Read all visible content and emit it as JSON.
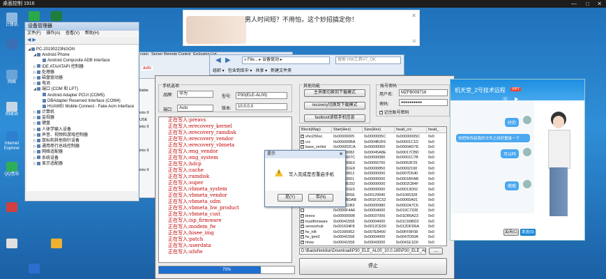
{
  "remote": {
    "title": "桌面控制 1916",
    "min": "—",
    "max": "□",
    "close": "✕"
  },
  "desktop_icons": [
    {
      "label": "计算机",
      "color": "#8fb8e0"
    },
    {
      "label": "",
      "color": "#2aa84a"
    },
    {
      "label": "",
      "color": "#1e7e3a"
    },
    {
      "label": "",
      "color": "#3a6fb5"
    },
    {
      "label": "网络",
      "color": "#6aa3d8"
    },
    {
      "label": "回收站",
      "color": "#c6d6e6"
    },
    {
      "label": "Internet Explorer",
      "color": "#2d7fd0"
    },
    {
      "label": "QQ音乐",
      "color": "#2fae58"
    },
    {
      "label": "",
      "color": "#d04040"
    },
    {
      "label": "",
      "color": "#e0e0e0"
    },
    {
      "label": "",
      "color": "#f0b030"
    },
    {
      "label": "",
      "color": "#2a6fd0"
    }
  ],
  "device_manager": {
    "title": "设备管理器",
    "menu": [
      "文件(F)",
      "操作(A)",
      "查看(V)",
      "帮助(H)"
    ],
    "tree": [
      {
        "indent": 0,
        "toggle": "◢",
        "label": "PC-20190223NGON"
      },
      {
        "indent": 1,
        "toggle": "◢",
        "label": "Android Phone"
      },
      {
        "indent": 2,
        "toggle": "",
        "label": "Android Composite ADB Interface"
      },
      {
        "indent": 1,
        "toggle": "▷",
        "label": "IDE ATA/ATAPI 控制器"
      },
      {
        "indent": 1,
        "toggle": "▷",
        "label": "处理器"
      },
      {
        "indent": 1,
        "toggle": "▷",
        "label": "磁盘驱动器"
      },
      {
        "indent": 1,
        "toggle": "▷",
        "label": "电池"
      },
      {
        "indent": 1,
        "toggle": "◢",
        "label": "端口 (COM 和 LPT)"
      },
      {
        "indent": 2,
        "toggle": "",
        "label": "Android Adapter PCUI (COM5)"
      },
      {
        "indent": 2,
        "toggle": "",
        "label": "DBAdapter Reserved Interface (COM4)"
      },
      {
        "indent": 2,
        "toggle": "",
        "label": "HUAWEI Mobile Connect - Fake Acm Interface"
      },
      {
        "indent": 1,
        "toggle": "▷",
        "label": "计算机"
      },
      {
        "indent": 1,
        "toggle": "▷",
        "label": "监视器"
      },
      {
        "indent": 1,
        "toggle": "▷",
        "label": "键盘"
      },
      {
        "indent": 1,
        "toggle": "▷",
        "label": "人体学输入设备"
      },
      {
        "indent": 1,
        "toggle": "▷",
        "label": "声音、视频和游戏控制器"
      },
      {
        "indent": 1,
        "toggle": "▷",
        "label": "鼠标和其他指针设备"
      },
      {
        "indent": 1,
        "toggle": "▷",
        "label": "通用串行总线控制器"
      },
      {
        "indent": 1,
        "toggle": "▷",
        "label": "网络适配器"
      },
      {
        "indent": 1,
        "toggle": "▷",
        "label": "系统设备"
      },
      {
        "indent": 1,
        "toggle": "▷",
        "label": "显示适配器"
      }
    ]
  },
  "explorer": {
    "path": "« File... ▸ 设备驱动 ▸",
    "search": "搜索 HW工具V7_OK",
    "menu": [
      "组织 ▾",
      "包含到库中 ▾",
      "共享 ▾",
      "新建文件夹"
    ],
    "bg_tabs": [
      "rsion",
      "Server",
      "Remote Control",
      "Exclusion List"
    ],
    "bg_auto": "auto",
    "bg_side": [
      "ilable",
      "into 9",
      "USE",
      "into 9",
      "into 9",
      "into 9"
    ]
  },
  "ad": {
    "text": "男人时间短？不用怕，这个妙招搞定你！",
    "close": "✕",
    "mark": "⊗"
  },
  "tool": {
    "phone_group": "手机选项",
    "brand_label": "品牌:",
    "brand_value": "华为",
    "model_label": "型号:",
    "model_value": "P30(ELE-AL00)",
    "port_label": "端口:",
    "port_value": "Auto",
    "version_label": "版本:",
    "version_value": "10.0.0.X",
    "func_group": "其他功能",
    "btn_fastboot_switch": "主界面切换到下载模式",
    "btn_recovery_switch": "recovery切换到下载模式",
    "btn_fastboot_read": "fastboot读取手机信息",
    "account_group": "账号密码",
    "user_label": "用户名:",
    "user_value": "MZFB009716",
    "pass_label": "密码:",
    "pass_value": "●●●●●●●●●●",
    "remember_label": "记住账号密码",
    "log_lines": [
      "正在写入:preavs",
      "正在写入:erecovery_kernel",
      "正在写入:erecovery_ramdisk",
      "正在写入:erecovery_vendor",
      "正在写入:erecovery_vbmeta",
      "正在写入:eng_vendor",
      "正在写入:eng_system",
      "正在写入:hdcp",
      "正在写入:cache",
      "正在写入:ramdisk",
      "正在写入:super",
      "正在写入:vbmeta_system",
      "正在写入:vbmeta_vendor",
      "正在写入:vbmeta_odm",
      "正在写入:vbmeta_hw_product",
      "正在写入:vbmeta_cust",
      "正在写入:isp_firmware",
      "正在写入:modem_fw",
      "正在写入:hisee_img",
      "正在写入:patch",
      "正在写入:userdata",
      "正在写入:ufsfw"
    ],
    "progress_text": "75%",
    "progress_value": 0.75,
    "columns": [
      "Block(Map)",
      "Start(Hex)",
      "Size(Hex)",
      "head_crc",
      "head_"
    ],
    "rows": [
      {
        "checked": true,
        "name": "xhci256sc",
        "start": "0x00000005",
        "size": "0x0000005C",
        "crc": "0x00000005C",
        "tail": "0x0"
      },
      {
        "checked": true,
        "name": "crc",
        "start": "0x000000BA",
        "size": "0x0004B2F6",
        "crc": "0x00001C1D",
        "tail": "0x0"
      },
      {
        "checked": true,
        "name": "base_verlist",
        "start": "0x000002CA",
        "size": "0x00000060",
        "crc": "0x0000AD7E",
        "tail": "0x0"
      },
      {
        "checked": false,
        "name": "",
        "start": "0x00000082",
        "size": "0x00045A8E",
        "crc": "0x00017CBD",
        "tail": "0x0"
      },
      {
        "checked": false,
        "name": "",
        "start": "0x0000007C",
        "size": "0x00000080",
        "crc": "0x00001C7B",
        "tail": "0x0"
      },
      {
        "checked": false,
        "name": "",
        "start": "0x000000E0",
        "size": "0x00056700",
        "crc": "0x00053F25",
        "tail": "0x0"
      },
      {
        "checked": false,
        "name": "",
        "start": "0x000001E8",
        "size": "0x00000850",
        "crc": "0x00002190",
        "tail": "0x0"
      },
      {
        "checked": false,
        "name": "",
        "start": "0x00000812",
        "size": "0x00000000",
        "crc": "0x0007D540",
        "tail": "0x0"
      },
      {
        "checked": false,
        "name": "",
        "start": "0x00000001",
        "size": "0x00000000",
        "crc": "0x0001BFAB",
        "tail": "0x0"
      },
      {
        "checked": false,
        "name": "",
        "start": "0x0000B202",
        "size": "0x00000000",
        "crc": "0x0002CB4F",
        "tail": "0x0"
      },
      {
        "checked": false,
        "name": "",
        "start": "0x000001E5",
        "size": "0x00000000",
        "crc": "0x00013D02",
        "tail": "0x0"
      },
      {
        "checked": false,
        "name": "",
        "start": "0x0000055E",
        "size": "0x00129940",
        "crc": "0x01065328",
        "tail": "0x0"
      },
      {
        "checked": false,
        "name": "",
        "start": "0x0001BDAB",
        "size": "0x001F2C52",
        "crc": "0x00065A01",
        "tail": "0x0"
      },
      {
        "checked": false,
        "name": "",
        "start": "0x000011B3",
        "size": "0x00000980",
        "crc": "0x0002A7C6",
        "tail": "0x0"
      },
      {
        "checked": false,
        "name": "",
        "start": "0x0000F4A6",
        "size": "0x00004000",
        "crc": "0x010C7328",
        "tail": "0x0"
      },
      {
        "checked": true,
        "name": "teeos",
        "start": "0x0000000B",
        "size": "0x00037000",
        "crc": "0x01D85A23",
        "tail": "0x0"
      },
      {
        "checked": true,
        "name": "trustfirmware",
        "start": "0x00041558",
        "size": "0x00004000",
        "crc": "0x01C66BD2",
        "tail": "0x0"
      },
      {
        "checked": true,
        "name": "sensorhub",
        "start": "0x001634F8",
        "size": "0x0012CE50",
        "crc": "0x012DFD6A",
        "tail": "0x0"
      },
      {
        "checked": true,
        "name": "fw_hifi",
        "start": "0x01090952",
        "size": "0x007E8400",
        "crc": "0x00FF8F08",
        "tail": "0x0"
      },
      {
        "checked": true,
        "name": "fw_lpm3",
        "start": "0x00041558",
        "size": "0x00004000",
        "crc": "0x0047D50A",
        "tail": "0x0"
      },
      {
        "checked": true,
        "name": "hhee",
        "start": "0x00041558",
        "size": "0x00043000",
        "crc": "0x0041E1D0",
        "tail": "0x0"
      }
    ],
    "file_path": "D:\\BaiduNetdisk\\Download\\P30_ELE_AL00_10.0.185\\P30_ELE_AL00_10.0.185\\",
    "browse_label": "...",
    "stop_label": "停止"
  },
  "dialog": {
    "title": "提示",
    "close": "✕",
    "message": "写入完成是否重启手机",
    "yes": "是(Y)",
    "no": "否(N)"
  },
  "qq": {
    "title": "机天堂_2号技术远程",
    "vip": "VIP7",
    "bubbles": [
      "好的",
      "你把你传给我的文件之间好重接一下",
      "可以吗",
      "嗯嗯"
    ],
    "close_label": "关闭(C)",
    "send_label": "发送(S)"
  },
  "colors": {
    "log_text": "#c00000",
    "progress": "#1f6fd0",
    "qq_blue": "#1e8fe0"
  }
}
